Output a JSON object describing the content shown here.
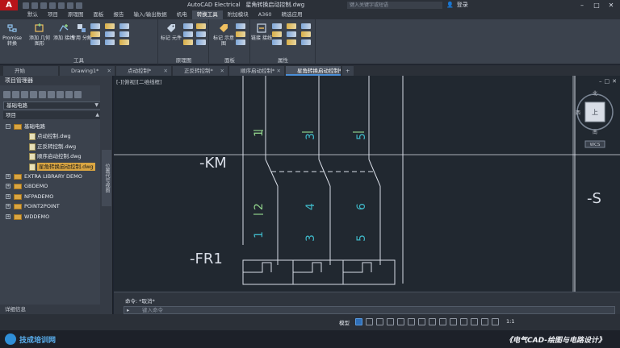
{
  "titlebar": {
    "app_name": "AutoCAD Electrical",
    "file_name": "星角转换启动控制.dwg",
    "search_placeholder": "键入关键字或短语",
    "user": "登录",
    "app_logo": "A"
  },
  "ribbon_tabs": [
    "默认",
    "项目",
    "原理图",
    "面板",
    "报告",
    "输入/输出数据",
    "机电",
    "转换工具",
    "附加模块",
    "A360",
    "精选应用"
  ],
  "ribbon_active_tab": "转换工具",
  "ribbon": {
    "tools_group": {
      "label": "工具",
      "buttons": [
        "Promise 转换",
        "添加 几何图形",
        "添加 接线",
        "专用 分解"
      ]
    },
    "schematic_group": {
      "label": "原理图",
      "buttons": [
        "标记 元件"
      ]
    },
    "panel_group": {
      "label": "面板",
      "buttons": [
        "标记 示意图"
      ]
    },
    "attribute_group": {
      "label": "属性",
      "buttons": [
        "链接 接线"
      ]
    }
  },
  "doc_tabs": [
    "开始",
    "Drawing1*",
    "点动控制*",
    "正反转控制*",
    "顺序启动控制*",
    "星角转换启动控制*"
  ],
  "doc_active_tab": "星角转换启动控制*",
  "project_manager": {
    "title": "项目管理器",
    "project_select": "基础电路",
    "subhead": "项目",
    "tree": [
      {
        "label": "基础电路",
        "type": "folder",
        "level": 0,
        "expanded": true,
        "selected": false
      },
      {
        "label": "点动控制.dwg",
        "type": "file",
        "level": 1,
        "selected": false
      },
      {
        "label": "正反转控制.dwg",
        "type": "file",
        "level": 1,
        "selected": false
      },
      {
        "label": "顺序启动控制.dwg",
        "type": "file",
        "level": 1,
        "selected": false
      },
      {
        "label": "星角转换启动控制.dwg",
        "type": "file",
        "level": 1,
        "selected": true
      },
      {
        "label": "EXTRA LIBRARY DEMO",
        "type": "folder",
        "level": 0,
        "expanded": false,
        "selected": false
      },
      {
        "label": "GBDEMO",
        "type": "folder",
        "level": 0,
        "expanded": false,
        "selected": false
      },
      {
        "label": "NFPADEMO",
        "type": "folder",
        "level": 0,
        "expanded": false,
        "selected": false
      },
      {
        "label": "POINT2POINT",
        "type": "folder",
        "level": 0,
        "expanded": false,
        "selected": false
      },
      {
        "label": "WDDEMO",
        "type": "folder",
        "level": 0,
        "expanded": false,
        "selected": false
      }
    ],
    "details_label": "详细信息",
    "side_tab": "位置代号视图"
  },
  "canvas": {
    "view_label": "[-][俯视][二维线框]",
    "labels": {
      "km": "-KM",
      "fr": "-FR1",
      "right": "-S"
    },
    "terminal_numbers": [
      "1",
      "3",
      "5",
      "2",
      "4",
      "6",
      "1",
      "3",
      "5"
    ],
    "viewcube": {
      "top": "北",
      "west": "西",
      "south": "南",
      "face": "上",
      "wcs": "WCS"
    }
  },
  "command_line": {
    "history": "命令: *取消*",
    "placeholder": "键入命令"
  },
  "statusbar": {
    "model": "模型",
    "scale": "1:1"
  },
  "banner": {
    "logo_text": "技成培训网",
    "course": "《电气CAD-绘图与电路设计》"
  },
  "colors": {
    "canvas_bg": "#212830",
    "line_white": "#d8dde6",
    "text_cyan": "#3fb8c8",
    "terminal_green": "#8fd08a",
    "selected_file_bg": "#d9a542"
  }
}
